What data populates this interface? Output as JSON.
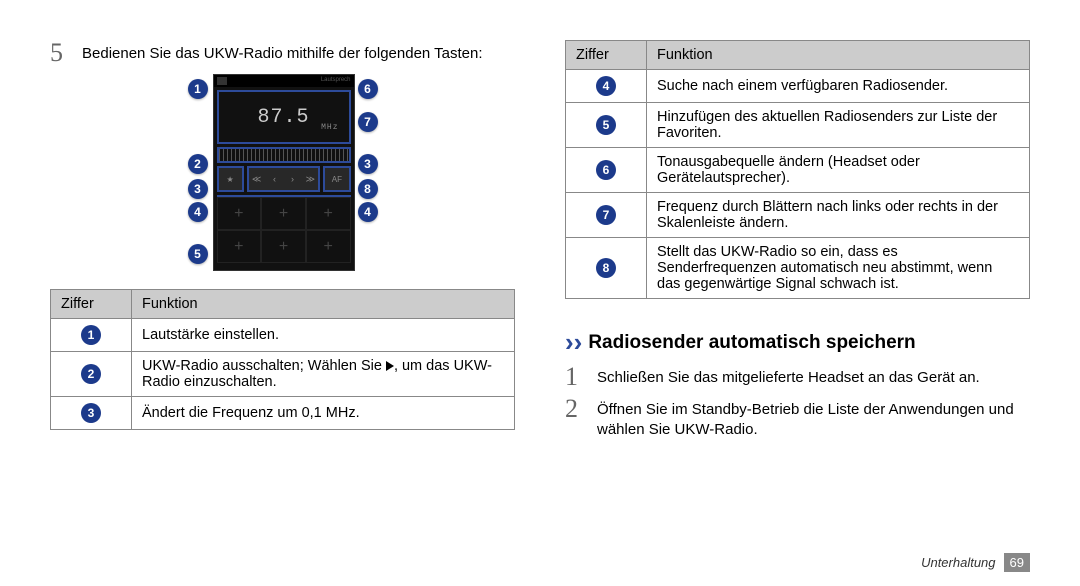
{
  "left": {
    "step5_num": "5",
    "step5_text": "Bedienen Sie das UKW-Radio mithilfe der folgenden Tasten:",
    "illustration": {
      "frequency": "87.5",
      "mhz": "MHz",
      "af_label": "AF",
      "speaker_label": "Lautsprech",
      "markers": {
        "b1": "1",
        "b2": "2",
        "b3": "3",
        "b4": "4",
        "b5": "5",
        "b6": "6",
        "b7": "7",
        "b8": "8"
      }
    },
    "table": {
      "head_ziffer": "Ziffer",
      "head_funktion": "Funktion",
      "rows": [
        {
          "num": "1",
          "text": "Lautstärke einstellen."
        },
        {
          "num": "2",
          "text_prefix": "UKW-Radio ausschalten; Wählen Sie ",
          "text_suffix": ", um das UKW-Radio einzuschalten."
        },
        {
          "num": "3",
          "text": "Ändert die Frequenz um 0,1 MHz."
        }
      ]
    }
  },
  "right": {
    "table": {
      "head_ziffer": "Ziffer",
      "head_funktion": "Funktion",
      "rows": [
        {
          "num": "4",
          "text": "Suche nach einem verfügbaren Radiosender."
        },
        {
          "num": "5",
          "text": "Hinzufügen des aktuellen Radiosenders zur Liste der Favoriten."
        },
        {
          "num": "6",
          "text": "Tonausgabequelle ändern (Headset oder Gerätelautsprecher)."
        },
        {
          "num": "7",
          "text": "Frequenz durch Blättern nach links oder rechts in der Skalenleiste ändern."
        },
        {
          "num": "8",
          "text": "Stellt das UKW-Radio so ein, dass es Senderfrequenzen automatisch neu abstimmt, wenn das gegenwärtige Signal schwach ist."
        }
      ]
    },
    "subhead": "Radiosender automatisch speichern",
    "step1_num": "1",
    "step1_text": "Schließen Sie das mitgelieferte Headset an das Gerät an.",
    "step2_num": "2",
    "step2_text": "Öffnen Sie im Standby-Betrieb die Liste der Anwendungen und wählen Sie UKW-Radio."
  },
  "footer": {
    "section": "Unterhaltung",
    "page": "69"
  }
}
